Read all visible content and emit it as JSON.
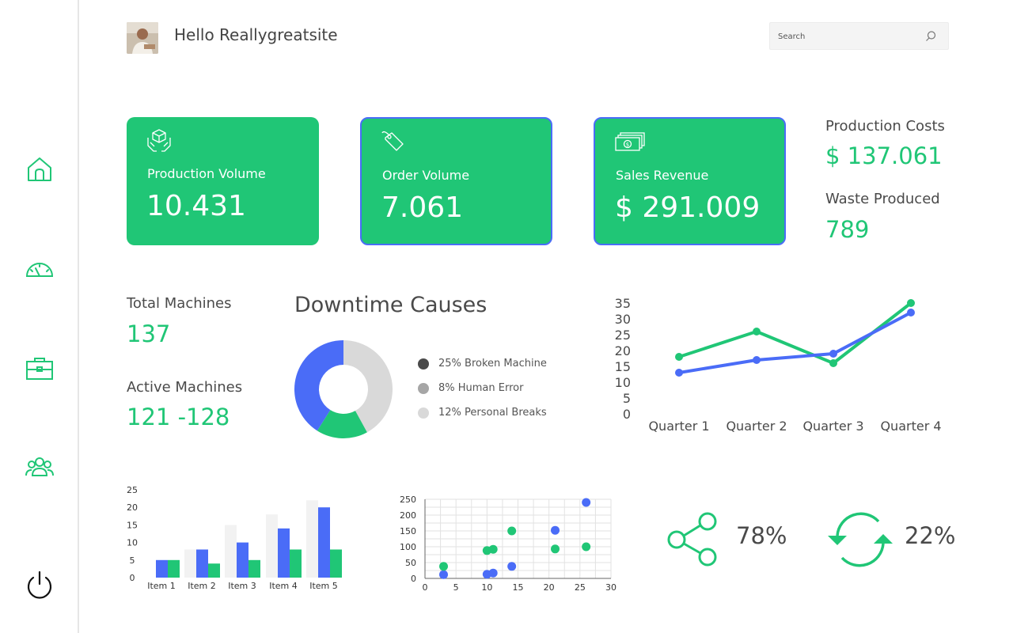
{
  "header": {
    "greeting": "Hello Reallygreatsite",
    "search_placeholder": "Search"
  },
  "sidebar": {
    "items": [
      {
        "icon": "home-icon"
      },
      {
        "icon": "speedometer-icon"
      },
      {
        "icon": "briefcase-icon"
      },
      {
        "icon": "users-icon"
      },
      {
        "icon": "power-icon"
      }
    ]
  },
  "colors": {
    "green": "#20c676",
    "blue": "#4a6cf7",
    "light_gray": "#d9d9d9",
    "dark_gray": "#4a4a4a"
  },
  "cards": [
    {
      "label": "Production Volume",
      "value": "10.431",
      "icon": "box-hands-icon"
    },
    {
      "label": "Order Volume",
      "value": "7.061",
      "icon": "tag-icon"
    },
    {
      "label": "Sales Revenue",
      "value": "$ 291.009",
      "icon": "money-icon"
    }
  ],
  "stats": {
    "production_costs_label": "Production Costs",
    "production_costs_value": "$ 137.061",
    "waste_label": "Waste Produced",
    "waste_value": "789",
    "total_machines_label": "Total Machines",
    "total_machines_value": "137",
    "active_machines_label": "Active Machines",
    "active_machines_value": "121 -128"
  },
  "downtime": {
    "title": "Downtime Causes",
    "legend": [
      {
        "label": "25% Broken Machine",
        "color": "#4a4a4a"
      },
      {
        "label": "8% Human Error",
        "color": "#a6a6a6"
      },
      {
        "label": "12% Personal Breaks",
        "color": "#d9d9d9"
      }
    ]
  },
  "chart_data": [
    {
      "type": "pie",
      "donut": true,
      "slices": [
        {
          "value": 42,
          "color": "#d9d9d9"
        },
        {
          "value": 17,
          "color": "#20c676"
        },
        {
          "value": 41,
          "color": "#4a6cf7"
        }
      ]
    },
    {
      "type": "line",
      "categories": [
        "Quarter 1",
        "Quarter 2",
        "Quarter 3",
        "Quarter 4"
      ],
      "yticks": [
        "35",
        "30",
        "25",
        "20",
        "15",
        "10",
        "5",
        "0"
      ],
      "ylim": [
        0,
        35
      ],
      "series": [
        {
          "color": "#20c676",
          "values": [
            18,
            26,
            16,
            35
          ]
        },
        {
          "color": "#4a6cf7",
          "values": [
            13,
            17,
            19,
            32
          ]
        }
      ]
    },
    {
      "type": "bar",
      "categories": [
        "Item 1",
        "Item 2",
        "Item 3",
        "Item 4",
        "Item 5"
      ],
      "yticks": [
        "25",
        "20",
        "15",
        "10",
        "5",
        "0"
      ],
      "ylim": [
        0,
        25
      ],
      "series": [
        {
          "color": "#f2f2f2",
          "values": [
            0,
            8,
            15,
            18,
            22
          ]
        },
        {
          "color": "#4a6cf7",
          "values": [
            5,
            8,
            10,
            14,
            20
          ]
        },
        {
          "color": "#20c676",
          "values": [
            5,
            4,
            5,
            8,
            8
          ]
        }
      ]
    },
    {
      "type": "scatter",
      "xlim": [
        0,
        30
      ],
      "ylim": [
        0,
        250
      ],
      "xticks": [
        "0",
        "5",
        "10",
        "15",
        "20",
        "25",
        "30"
      ],
      "yticks": [
        "250",
        "200",
        "150",
        "100",
        "50",
        "0"
      ],
      "grid": true,
      "series": [
        {
          "color": "#4a6cf7",
          "points": [
            [
              3,
              12
            ],
            [
              10,
              13
            ],
            [
              11,
              17
            ],
            [
              14,
              38
            ],
            [
              21,
              152
            ],
            [
              26,
              240
            ]
          ]
        },
        {
          "color": "#20c676",
          "points": [
            [
              3,
              38
            ],
            [
              10,
              88
            ],
            [
              11,
              92
            ],
            [
              14,
              150
            ],
            [
              21,
              93
            ],
            [
              26,
              100
            ]
          ]
        }
      ]
    }
  ],
  "indicators": [
    {
      "icon": "share-icon",
      "value": "78%"
    },
    {
      "icon": "refresh-icon",
      "value": "22%"
    }
  ]
}
